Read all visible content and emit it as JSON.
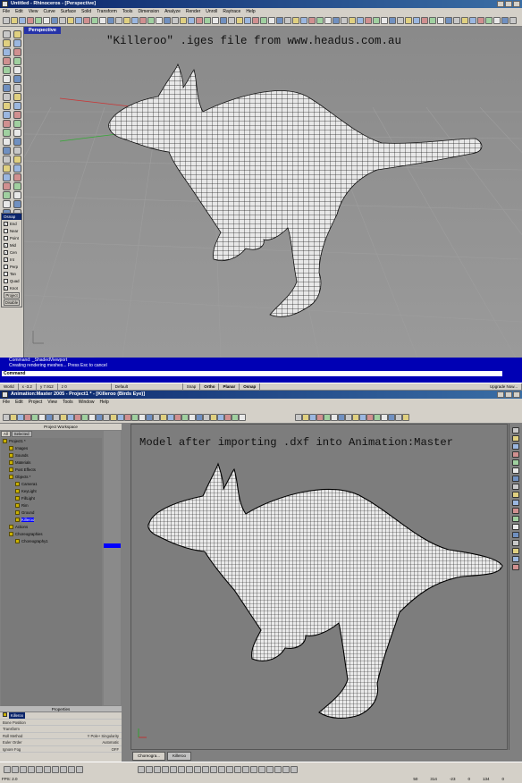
{
  "rhino": {
    "title": "Untitled - Rhinoceros - [Perspective]",
    "menu": [
      "File",
      "Edit",
      "View",
      "Curve",
      "Surface",
      "Solid",
      "Transform",
      "Tools",
      "Dimension",
      "Analyze",
      "Render",
      "Unroll",
      "Raytrace",
      "Help"
    ],
    "viewport_label": "Perspective",
    "caption": "\"Killeroo\" .iges file from www.headus.com.au",
    "osnap": {
      "title": "Osnap",
      "items": [
        {
          "label": "End",
          "checked": true
        },
        {
          "label": "Near",
          "checked": false
        },
        {
          "label": "Point",
          "checked": false
        },
        {
          "label": "Mid",
          "checked": true
        },
        {
          "label": "Cen",
          "checked": true
        },
        {
          "label": "Int",
          "checked": true
        },
        {
          "label": "Perp",
          "checked": false
        },
        {
          "label": "Tan",
          "checked": false
        },
        {
          "label": "Quad",
          "checked": false
        },
        {
          "label": "Knot",
          "checked": true
        }
      ],
      "project_btn": "Project",
      "disable_btn": "Disable"
    },
    "command_history_1": "Command: _ShadedViewport",
    "command_history_2": "Creating rendering meshes... Press Esc to cancel",
    "command_prompt": "Command",
    "status": {
      "world": "World",
      "x": "x -3.2",
      "y": "y 7.912",
      "z": "z 0",
      "layer": "Default",
      "snap": "Snap",
      "ortho": "Ortho",
      "planar": "Planar",
      "osnap": "Osnap",
      "upgrade": "Upgrade Now..."
    }
  },
  "am": {
    "title": "Animation:Master 2005 - Project1 * - [Killeroo (Birds Eye)]",
    "menu": [
      "File",
      "Edit",
      "Project",
      "View",
      "Tools",
      "Window",
      "Help"
    ],
    "workspace_title": "Project Workspace",
    "tabs": [
      "All",
      "Selected"
    ],
    "tree": [
      {
        "label": "Project1 *",
        "indent": 0
      },
      {
        "label": "Images",
        "indent": 1
      },
      {
        "label": "Sounds",
        "indent": 1
      },
      {
        "label": "Materials",
        "indent": 1
      },
      {
        "label": "Post Effects",
        "indent": 1
      },
      {
        "label": "Objects *",
        "indent": 1
      },
      {
        "label": "Camera1",
        "indent": 2
      },
      {
        "label": "KeyLight",
        "indent": 2
      },
      {
        "label": "FillLight",
        "indent": 2
      },
      {
        "label": "Rim",
        "indent": 2
      },
      {
        "label": "Ground",
        "indent": 2
      },
      {
        "label": "Killeroo",
        "indent": 2,
        "selected": true
      },
      {
        "label": "Actions",
        "indent": 1
      },
      {
        "label": "Choreographies",
        "indent": 1
      },
      {
        "label": "Choreography1",
        "indent": 2
      }
    ],
    "caption": "Model after importing .dxf into Animation:Master",
    "properties": {
      "title": "Properties",
      "selected": "Killeroo",
      "rows": [
        {
          "label": "Bone Position",
          "value": ""
        },
        {
          "label": "Transform",
          "value": ""
        },
        {
          "label": "Roll Method",
          "value": "Y Pole+ Singularity"
        },
        {
          "label": "Euler Order",
          "value": "Automatic"
        },
        {
          "label": "Ignore Fog",
          "value": "OFF"
        }
      ]
    },
    "doc_tabs": [
      "Choreogra...",
      "Killeroo"
    ],
    "fps": "FPS: 2.0",
    "status_numbers": [
      "50",
      "314",
      "-23",
      "0",
      "134",
      "0"
    ]
  },
  "colors": {
    "titlebar": "#0a246a",
    "command_bg": "#0000b4",
    "viewport_bg": "#8c8c8c",
    "selection": "#0000ff"
  }
}
